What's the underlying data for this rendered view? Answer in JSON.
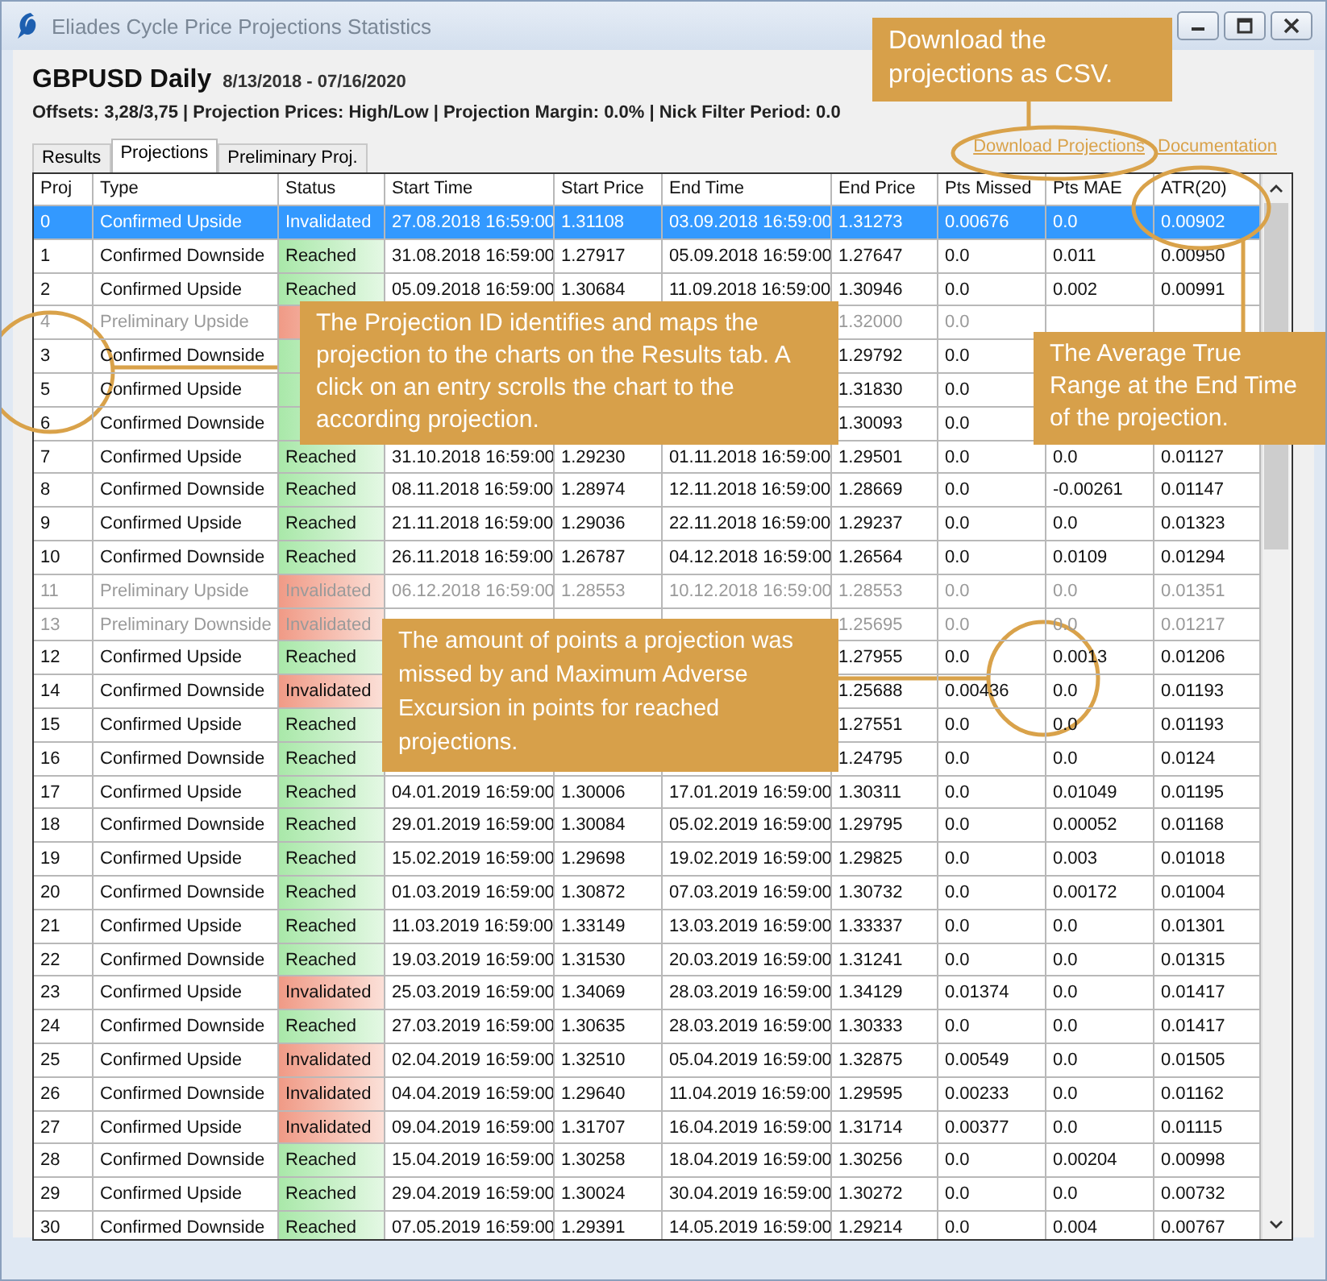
{
  "window": {
    "title": "Eliades Cycle Price Projections Statistics"
  },
  "heading": {
    "symbol": "GBPUSD Daily",
    "date_range": "8/13/2018 - 07/16/2020",
    "settings": "Offsets: 3,28/3,75 | Projection Prices: High/Low | Projection Margin: 0.0% | Nick Filter Period: 0.0"
  },
  "tabs": [
    {
      "label": "Results",
      "selected": false
    },
    {
      "label": "Projections",
      "selected": true
    },
    {
      "label": "Preliminary Proj.",
      "selected": false
    }
  ],
  "links": [
    "Download Projections",
    "Documentation"
  ],
  "table": {
    "columns": [
      "Proj",
      "Type",
      "Status",
      "Start Time",
      "Start Price",
      "End Time",
      "End Price",
      "Pts Missed",
      "Pts MAE",
      "ATR(20)"
    ],
    "rows": [
      {
        "proj": "0",
        "type": "Confirmed Upside",
        "status": "Invalidated",
        "invalidated": true,
        "start_time": "27.08.2018 16:59:00",
        "start_price": "1.31108",
        "end_time": "03.09.2018 16:59:00",
        "end_price": "1.31273",
        "pts_missed": "0.00676",
        "pts_mae": "0.0",
        "atr": "0.00902",
        "selected": true,
        "preliminary": false
      },
      {
        "proj": "1",
        "type": "Confirmed Downside",
        "status": "Reached",
        "invalidated": false,
        "start_time": "31.08.2018 16:59:00",
        "start_price": "1.27917",
        "end_time": "05.09.2018 16:59:00",
        "end_price": "1.27647",
        "pts_missed": "0.0",
        "pts_mae": "0.011",
        "atr": "0.00950",
        "selected": false,
        "preliminary": false
      },
      {
        "proj": "2",
        "type": "Confirmed Upside",
        "status": "Reached",
        "invalidated": false,
        "start_time": "05.09.2018 16:59:00",
        "start_price": "1.30684",
        "end_time": "11.09.2018 16:59:00",
        "end_price": "1.30946",
        "pts_missed": "0.0",
        "pts_mae": "0.002",
        "atr": "0.00991",
        "selected": false,
        "preliminary": false
      },
      {
        "proj": "4",
        "type": "Preliminary Upside",
        "invalidated": true,
        "end_price": "1.32000",
        "pts_missed": "0.0",
        "selected": false,
        "preliminary": true
      },
      {
        "proj": "3",
        "type": "Confirmed Downside",
        "invalidated": false,
        "end_price": "1.29792",
        "pts_missed": "0.0",
        "selected": false,
        "preliminary": false
      },
      {
        "proj": "5",
        "type": "Confirmed Upside",
        "invalidated": false,
        "end_price": "1.31830",
        "pts_missed": "0.0",
        "selected": false,
        "preliminary": false
      },
      {
        "proj": "6",
        "type": "Confirmed Downside",
        "invalidated": false,
        "end_price": "1.30093",
        "pts_missed": "0.0",
        "selected": false,
        "preliminary": false
      },
      {
        "proj": "7",
        "type": "Confirmed Upside",
        "status": "Reached",
        "invalidated": false,
        "start_time": "31.10.2018 16:59:00",
        "start_price": "1.29230",
        "end_time": "01.11.2018 16:59:00",
        "end_price": "1.29501",
        "pts_missed": "0.0",
        "pts_mae": "0.0",
        "atr": "0.01127",
        "selected": false,
        "preliminary": false
      },
      {
        "proj": "8",
        "type": "Confirmed Downside",
        "status": "Reached",
        "invalidated": false,
        "start_time": "08.11.2018 16:59:00",
        "start_price": "1.28974",
        "end_time": "12.11.2018 16:59:00",
        "end_price": "1.28669",
        "pts_missed": "0.0",
        "pts_mae": "-0.00261",
        "atr": "0.01147",
        "selected": false,
        "preliminary": false
      },
      {
        "proj": "9",
        "type": "Confirmed Upside",
        "status": "Reached",
        "invalidated": false,
        "start_time": "21.11.2018 16:59:00",
        "start_price": "1.29036",
        "end_time": "22.11.2018 16:59:00",
        "end_price": "1.29237",
        "pts_missed": "0.0",
        "pts_mae": "0.0",
        "atr": "0.01323",
        "selected": false,
        "preliminary": false
      },
      {
        "proj": "10",
        "type": "Confirmed Downside",
        "status": "Reached",
        "invalidated": false,
        "start_time": "26.11.2018 16:59:00",
        "start_price": "1.26787",
        "end_time": "04.12.2018 16:59:00",
        "end_price": "1.26564",
        "pts_missed": "0.0",
        "pts_mae": "0.0109",
        "atr": "0.01294",
        "selected": false,
        "preliminary": false
      },
      {
        "proj": "11",
        "type": "Preliminary Upside",
        "status": "Invalidated",
        "invalidated": true,
        "start_time": "06.12.2018 16:59:00",
        "start_price": "1.28553",
        "end_time": "10.12.2018 16:59:00",
        "end_price": "1.28553",
        "pts_missed": "0.0",
        "pts_mae": "0.0",
        "atr": "0.01351",
        "selected": false,
        "preliminary": true
      },
      {
        "proj": "13",
        "type": "Preliminary Downside",
        "status": "Invalidated",
        "invalidated": true,
        "end_price": "1.25695",
        "pts_missed": "0.0",
        "pts_mae": "0.0",
        "atr": "0.01217",
        "selected": false,
        "preliminary": true
      },
      {
        "proj": "12",
        "type": "Confirmed Upside",
        "status": "Reached",
        "invalidated": false,
        "end_price": "1.27955",
        "pts_missed": "0.0",
        "pts_mae": "0.0013",
        "atr": "0.01206",
        "selected": false,
        "preliminary": false
      },
      {
        "proj": "14",
        "type": "Confirmed Downside",
        "status": "Invalidated",
        "invalidated": true,
        "end_price": "1.25688",
        "pts_missed": "0.00436",
        "pts_mae": "0.0",
        "atr": "0.01193",
        "selected": false,
        "preliminary": false
      },
      {
        "proj": "15",
        "type": "Confirmed Upside",
        "status": "Reached",
        "invalidated": false,
        "end_price": "1.27551",
        "pts_missed": "0.0",
        "pts_mae": "0.0",
        "atr": "0.01193",
        "selected": false,
        "preliminary": false
      },
      {
        "proj": "16",
        "type": "Confirmed Downside",
        "status": "Reached",
        "invalidated": false,
        "end_price": "1.24795",
        "pts_missed": "0.0",
        "pts_mae": "0.0",
        "atr": "0.0124",
        "selected": false,
        "preliminary": false
      },
      {
        "proj": "17",
        "type": "Confirmed Upside",
        "status": "Reached",
        "invalidated": false,
        "start_time": "04.01.2019 16:59:00",
        "start_price": "1.30006",
        "end_time": "17.01.2019 16:59:00",
        "end_price": "1.30311",
        "pts_missed": "0.0",
        "pts_mae": "0.01049",
        "atr": "0.01195",
        "selected": false,
        "preliminary": false
      },
      {
        "proj": "18",
        "type": "Confirmed Downside",
        "status": "Reached",
        "invalidated": false,
        "start_time": "29.01.2019 16:59:00",
        "start_price": "1.30084",
        "end_time": "05.02.2019 16:59:00",
        "end_price": "1.29795",
        "pts_missed": "0.0",
        "pts_mae": "0.00052",
        "atr": "0.01168",
        "selected": false,
        "preliminary": false
      },
      {
        "proj": "19",
        "type": "Confirmed Upside",
        "status": "Reached",
        "invalidated": false,
        "start_time": "15.02.2019 16:59:00",
        "start_price": "1.29698",
        "end_time": "19.02.2019 16:59:00",
        "end_price": "1.29825",
        "pts_missed": "0.0",
        "pts_mae": "0.003",
        "atr": "0.01018",
        "selected": false,
        "preliminary": false
      },
      {
        "proj": "20",
        "type": "Confirmed Downside",
        "status": "Reached",
        "invalidated": false,
        "start_time": "01.03.2019 16:59:00",
        "start_price": "1.30872",
        "end_time": "07.03.2019 16:59:00",
        "end_price": "1.30732",
        "pts_missed": "0.0",
        "pts_mae": "0.00172",
        "atr": "0.01004",
        "selected": false,
        "preliminary": false
      },
      {
        "proj": "21",
        "type": "Confirmed Upside",
        "status": "Reached",
        "invalidated": false,
        "start_time": "11.03.2019 16:59:00",
        "start_price": "1.33149",
        "end_time": "13.03.2019 16:59:00",
        "end_price": "1.33337",
        "pts_missed": "0.0",
        "pts_mae": "0.0",
        "atr": "0.01301",
        "selected": false,
        "preliminary": false
      },
      {
        "proj": "22",
        "type": "Confirmed Downside",
        "status": "Reached",
        "invalidated": false,
        "start_time": "19.03.2019 16:59:00",
        "start_price": "1.31530",
        "end_time": "20.03.2019 16:59:00",
        "end_price": "1.31241",
        "pts_missed": "0.0",
        "pts_mae": "0.0",
        "atr": "0.01315",
        "selected": false,
        "preliminary": false
      },
      {
        "proj": "23",
        "type": "Confirmed Upside",
        "status": "Invalidated",
        "invalidated": true,
        "start_time": "25.03.2019 16:59:00",
        "start_price": "1.34069",
        "end_time": "28.03.2019 16:59:00",
        "end_price": "1.34129",
        "pts_missed": "0.01374",
        "pts_mae": "0.0",
        "atr": "0.01417",
        "selected": false,
        "preliminary": false
      },
      {
        "proj": "24",
        "type": "Confirmed Downside",
        "status": "Reached",
        "invalidated": false,
        "start_time": "27.03.2019 16:59:00",
        "start_price": "1.30635",
        "end_time": "28.03.2019 16:59:00",
        "end_price": "1.30333",
        "pts_missed": "0.0",
        "pts_mae": "0.0",
        "atr": "0.01417",
        "selected": false,
        "preliminary": false
      },
      {
        "proj": "25",
        "type": "Confirmed Upside",
        "status": "Invalidated",
        "invalidated": true,
        "start_time": "02.04.2019 16:59:00",
        "start_price": "1.32510",
        "end_time": "05.04.2019 16:59:00",
        "end_price": "1.32875",
        "pts_missed": "0.00549",
        "pts_mae": "0.0",
        "atr": "0.01505",
        "selected": false,
        "preliminary": false
      },
      {
        "proj": "26",
        "type": "Confirmed Downside",
        "status": "Invalidated",
        "invalidated": true,
        "start_time": "04.04.2019 16:59:00",
        "start_price": "1.29640",
        "end_time": "11.04.2019 16:59:00",
        "end_price": "1.29595",
        "pts_missed": "0.00233",
        "pts_mae": "0.0",
        "atr": "0.01162",
        "selected": false,
        "preliminary": false
      },
      {
        "proj": "27",
        "type": "Confirmed Upside",
        "status": "Invalidated",
        "invalidated": true,
        "start_time": "09.04.2019 16:59:00",
        "start_price": "1.31707",
        "end_time": "16.04.2019 16:59:00",
        "end_price": "1.31714",
        "pts_missed": "0.00377",
        "pts_mae": "0.0",
        "atr": "0.01115",
        "selected": false,
        "preliminary": false
      },
      {
        "proj": "28",
        "type": "Confirmed Downside",
        "status": "Reached",
        "invalidated": false,
        "start_time": "15.04.2019 16:59:00",
        "start_price": "1.30258",
        "end_time": "18.04.2019 16:59:00",
        "end_price": "1.30256",
        "pts_missed": "0.0",
        "pts_mae": "0.00204",
        "atr": "0.00998",
        "selected": false,
        "preliminary": false
      },
      {
        "proj": "29",
        "type": "Confirmed Upside",
        "status": "Reached",
        "invalidated": false,
        "start_time": "29.04.2019 16:59:00",
        "start_price": "1.30024",
        "end_time": "30.04.2019 16:59:00",
        "end_price": "1.30272",
        "pts_missed": "0.0",
        "pts_mae": "0.0",
        "atr": "0.00732",
        "selected": false,
        "preliminary": false
      },
      {
        "proj": "30",
        "type": "Confirmed Downside",
        "status": "Reached",
        "invalidated": false,
        "start_time": "07.05.2019 16:59:00",
        "start_price": "1.29391",
        "end_time": "14.05.2019 16:59:00",
        "end_price": "1.29214",
        "pts_missed": "0.0",
        "pts_mae": "0.004",
        "atr": "0.00767",
        "selected": false,
        "preliminary": false
      }
    ]
  },
  "callouts": [
    {
      "text": "Download the projections as CSV."
    },
    {
      "text": "The Projection ID identifies and maps the projection to the charts on the Results tab. A click on an entry scrolls the chart to the according projection."
    },
    {
      "text": "The Average True Range at the End Time of the projection."
    },
    {
      "text": "The amount of points a projection was missed by and Maximum Adverse Excursion in points for reached projections."
    }
  ]
}
